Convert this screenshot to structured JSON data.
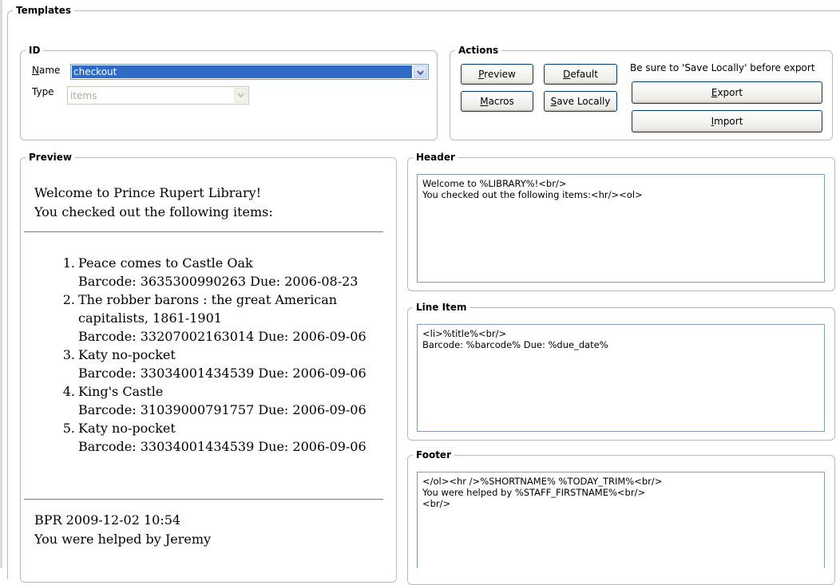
{
  "templates": {
    "legend": "Templates"
  },
  "id_group": {
    "legend": "ID",
    "name_label": "Name",
    "name_value": "checkout",
    "type_label": "Type",
    "type_value": "items"
  },
  "actions": {
    "legend": "Actions",
    "preview_label": "Preview",
    "default_label": "Default",
    "macros_label": "Macros",
    "save_locally_label": "Save Locally",
    "note": "Be sure to 'Save Locally' before export",
    "export_label": "Export",
    "import_label": "Import"
  },
  "preview": {
    "legend": "Preview",
    "greeting_line1": "Welcome to Prince Rupert Library!",
    "greeting_line2": "You checked out the following items:",
    "items": [
      {
        "num": "1.",
        "title": "Peace comes to Castle Oak",
        "barcode_line": "Barcode: 3635300990263 Due: 2006-08-23"
      },
      {
        "num": "2.",
        "title": "The robber barons : the great American",
        "title2": "capitalists, 1861-1901",
        "barcode_line": "Barcode: 33207002163014 Due: 2006-09-06"
      },
      {
        "num": "3.",
        "title": "Katy no-pocket",
        "barcode_line": "Barcode: 33034001434539 Due: 2006-09-06"
      },
      {
        "num": "4.",
        "title": "King's Castle",
        "barcode_line": "Barcode: 31039000791757 Due: 2006-09-06"
      },
      {
        "num": "5.",
        "title": "Katy no-pocket",
        "barcode_line": "Barcode: 33034001434539 Due: 2006-09-06"
      }
    ],
    "footer_line1": "BPR 2009-12-02 10:54",
    "footer_line2": "You were helped by Jeremy"
  },
  "header_group": {
    "legend": "Header",
    "text": "Welcome to %LIBRARY%!<br/>\nYou checked out the following items:<hr/><ol>"
  },
  "line_item_group": {
    "legend": "Line Item",
    "text": "<li>%title%<br/>\nBarcode: %barcode% Due: %due_date%"
  },
  "footer_group": {
    "legend": "Footer",
    "text": "</ol><hr />%SHORTNAME% %TODAY_TRIM%<br/>\nYou were helped by %STAFF_FIRSTNAME%<br/>\n<br/>"
  },
  "icons": {
    "dropdown": "chevron-down-icon"
  }
}
